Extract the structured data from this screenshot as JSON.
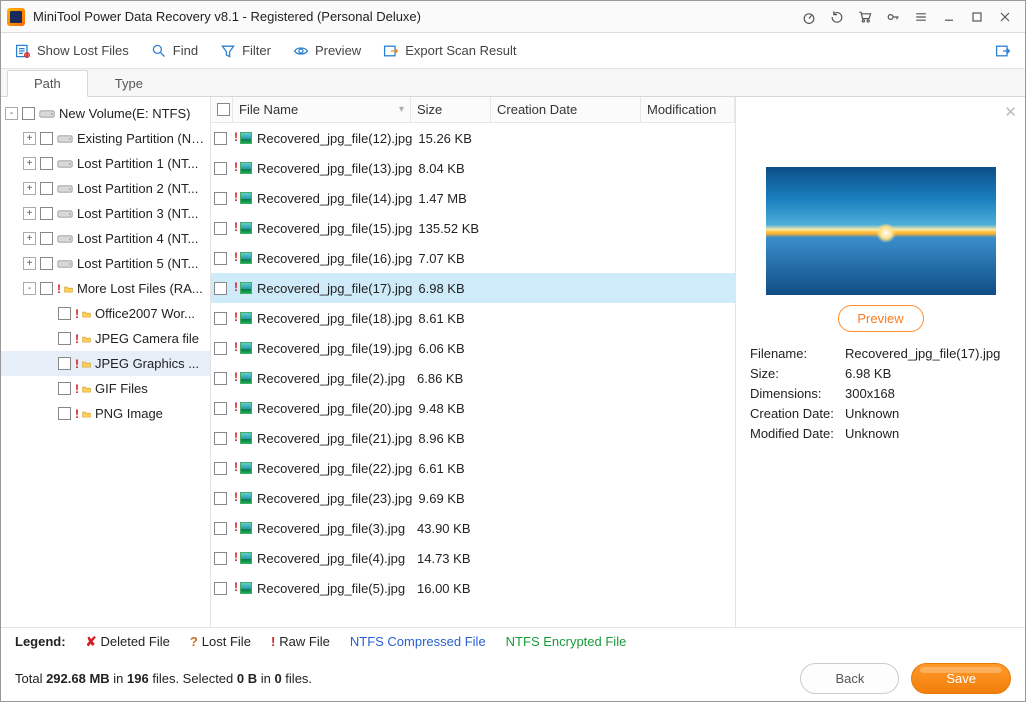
{
  "title": "MiniTool Power Data Recovery v8.1 - Registered (Personal Deluxe)",
  "toolbar": {
    "show_lost": "Show Lost Files",
    "find": "Find",
    "filter": "Filter",
    "preview": "Preview",
    "export": "Export Scan Result"
  },
  "tabs": {
    "path": "Path",
    "type": "Type"
  },
  "tree": [
    {
      "depth": 0,
      "exp": "-",
      "icon": "drive",
      "label": "New Volume(E: NTFS)"
    },
    {
      "depth": 1,
      "exp": "+",
      "icon": "drive",
      "label": "Existing Partition (N...)"
    },
    {
      "depth": 1,
      "exp": "+",
      "icon": "drive",
      "label": "Lost Partition 1 (NT..."
    },
    {
      "depth": 1,
      "exp": "+",
      "icon": "drive",
      "label": "Lost Partition 2 (NT..."
    },
    {
      "depth": 1,
      "exp": "+",
      "icon": "drive",
      "label": "Lost Partition 3 (NT..."
    },
    {
      "depth": 1,
      "exp": "+",
      "icon": "drive",
      "label": "Lost Partition 4 (NT..."
    },
    {
      "depth": 1,
      "exp": "+",
      "icon": "drive",
      "label": "Lost Partition 5 (NT..."
    },
    {
      "depth": 1,
      "exp": "-",
      "icon": "raw",
      "label": "More Lost Files (RA..."
    },
    {
      "depth": 2,
      "exp": " ",
      "icon": "raw",
      "label": "Office2007 Wor..."
    },
    {
      "depth": 2,
      "exp": " ",
      "icon": "raw",
      "label": "JPEG Camera file"
    },
    {
      "depth": 2,
      "exp": " ",
      "icon": "raw",
      "label": "JPEG Graphics ...",
      "selected": true
    },
    {
      "depth": 2,
      "exp": " ",
      "icon": "raw",
      "label": "GIF Files"
    },
    {
      "depth": 2,
      "exp": " ",
      "icon": "raw",
      "label": "PNG Image"
    }
  ],
  "columns": {
    "name": "File Name",
    "size": "Size",
    "creation": "Creation Date",
    "modification": "Modification"
  },
  "files": [
    {
      "name": "Recovered_jpg_file(12).jpg",
      "size": "15.26 KB"
    },
    {
      "name": "Recovered_jpg_file(13).jpg",
      "size": "8.04 KB"
    },
    {
      "name": "Recovered_jpg_file(14).jpg",
      "size": "1.47 MB"
    },
    {
      "name": "Recovered_jpg_file(15).jpg",
      "size": "135.52 KB"
    },
    {
      "name": "Recovered_jpg_file(16).jpg",
      "size": "7.07 KB"
    },
    {
      "name": "Recovered_jpg_file(17).jpg",
      "size": "6.98 KB",
      "selected": true
    },
    {
      "name": "Recovered_jpg_file(18).jpg",
      "size": "8.61 KB"
    },
    {
      "name": "Recovered_jpg_file(19).jpg",
      "size": "6.06 KB"
    },
    {
      "name": "Recovered_jpg_file(2).jpg",
      "size": "6.86 KB"
    },
    {
      "name": "Recovered_jpg_file(20).jpg",
      "size": "9.48 KB"
    },
    {
      "name": "Recovered_jpg_file(21).jpg",
      "size": "8.96 KB"
    },
    {
      "name": "Recovered_jpg_file(22).jpg",
      "size": "6.61 KB"
    },
    {
      "name": "Recovered_jpg_file(23).jpg",
      "size": "9.69 KB"
    },
    {
      "name": "Recovered_jpg_file(3).jpg",
      "size": "43.90 KB"
    },
    {
      "name": "Recovered_jpg_file(4).jpg",
      "size": "14.73 KB"
    },
    {
      "name": "Recovered_jpg_file(5).jpg",
      "size": "16.00 KB"
    }
  ],
  "preview": {
    "button": "Preview",
    "labels": {
      "filename": "Filename:",
      "size": "Size:",
      "dimensions": "Dimensions:",
      "creation": "Creation Date:",
      "modified": "Modified Date:"
    },
    "values": {
      "filename": "Recovered_jpg_file(17).jpg",
      "size": "6.98 KB",
      "dimensions": "300x168",
      "creation": "Unknown",
      "modified": "Unknown"
    }
  },
  "legend": {
    "title": "Legend:",
    "deleted": "Deleted File",
    "lost": "Lost File",
    "raw": "Raw File",
    "ntfs_compressed": "NTFS Compressed File",
    "ntfs_encrypted": "NTFS Encrypted File"
  },
  "status": {
    "total_prefix": "Total ",
    "total_size": "292.68 MB",
    "in": " in ",
    "total_files": "196",
    "files_suffix": " files.  Selected ",
    "sel_bytes": "0 B",
    "in2": " in ",
    "sel_count": "0",
    "suffix": " files."
  },
  "buttons": {
    "back": "Back",
    "save": "Save"
  }
}
